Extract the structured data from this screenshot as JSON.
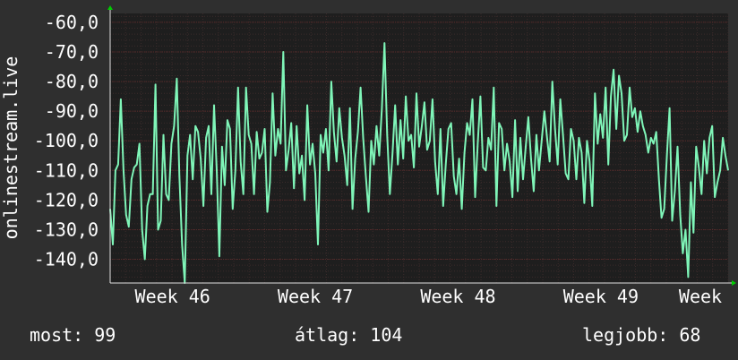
{
  "colors": {
    "background": "#2f2f2f",
    "plot_background": "#1e1e1e",
    "line": "#7ff5b8",
    "grid": "#5a2a2a",
    "axis": "#e0e0e0",
    "arrow": "#00cc00"
  },
  "stats": {
    "most": "most: 99",
    "atlag": "átlag: 104",
    "legjobb": "legjobb: 68"
  },
  "chart_data": {
    "type": "line",
    "ylabel": "onlinestream.live",
    "ylim": [
      -148,
      -57
    ],
    "y_ticks": [
      -60,
      -70,
      -80,
      -90,
      -100,
      -110,
      -120,
      -130,
      -140
    ],
    "y_tick_labels": [
      "-60,0",
      "-70,0",
      "-80,0",
      "-90,0",
      "-100,0",
      "-110,0",
      "-120,0",
      "-130,0",
      "-140,0"
    ],
    "x_range": [
      0,
      100
    ],
    "x_ticks": [
      {
        "x": 10.1,
        "label": "Week 46"
      },
      {
        "x": 33.2,
        "label": "Week 47"
      },
      {
        "x": 56.3,
        "label": "Week 48"
      },
      {
        "x": 79.4,
        "label": "Week 49"
      },
      {
        "x": 102.5,
        "label": "Week"
      }
    ],
    "grid": true,
    "series": [
      {
        "values": [
          -123,
          -135,
          -110,
          -108,
          -86,
          -110,
          -125,
          -129,
          -113,
          -109,
          -108,
          -101,
          -130,
          -140,
          -122,
          -118,
          -118,
          -81,
          -130,
          -127,
          -98,
          -118,
          -120,
          -101,
          -95,
          -79,
          -112,
          -135,
          -148,
          -105,
          -98,
          -113,
          -95,
          -97,
          -106,
          -122,
          -99,
          -95,
          -118,
          -88,
          -110,
          -139,
          -102,
          -115,
          -93,
          -96,
          -123,
          -110,
          -82,
          -107,
          -118,
          -82,
          -98,
          -101,
          -118,
          -97,
          -106,
          -104,
          -96,
          -124,
          -114,
          -84,
          -105,
          -96,
          -101,
          -70,
          -110,
          -103,
          -94,
          -116,
          -95,
          -111,
          -105,
          -120,
          -88,
          -108,
          -101,
          -111,
          -135,
          -98,
          -104,
          -96,
          -110,
          -80,
          -97,
          -107,
          -89,
          -99,
          -105,
          -115,
          -89,
          -123,
          -106,
          -97,
          -82,
          -99,
          -112,
          -124,
          -100,
          -108,
          -95,
          -105,
          -89,
          -67,
          -98,
          -118,
          -104,
          -88,
          -108,
          -93,
          -106,
          -85,
          -100,
          -98,
          -109,
          -84,
          -102,
          -95,
          -87,
          -103,
          -100,
          -86,
          -107,
          -118,
          -96,
          -122,
          -108,
          -96,
          -94,
          -112,
          -118,
          -106,
          -123,
          -104,
          -94,
          -98,
          -86,
          -119,
          -101,
          -85,
          -109,
          -110,
          -99,
          -103,
          -82,
          -122,
          -94,
          -96,
          -110,
          -101,
          -107,
          -119,
          -93,
          -117,
          -99,
          -113,
          -102,
          -92,
          -106,
          -117,
          -98,
          -110,
          -100,
          -90,
          -99,
          -107,
          -80,
          -96,
          -108,
          -86,
          -98,
          -111,
          -113,
          -96,
          -100,
          -113,
          -99,
          -104,
          -121,
          -100,
          -107,
          -122,
          -84,
          -101,
          -91,
          -99,
          -82,
          -108,
          -85,
          -76,
          -96,
          -78,
          -84,
          -100,
          -98,
          -82,
          -92,
          -89,
          -97,
          -90,
          -95,
          -98,
          -104,
          -99,
          -101,
          -97,
          -113,
          -126,
          -123,
          -105,
          -89,
          -127,
          -117,
          -102,
          -125,
          -138,
          -130,
          -146,
          -114,
          -131,
          -102,
          -109,
          -118,
          -100,
          -111,
          -99,
          -95,
          -119,
          -114,
          -110,
          -99,
          -105,
          -110
        ],
        "color": "#7ff5b8"
      }
    ]
  }
}
